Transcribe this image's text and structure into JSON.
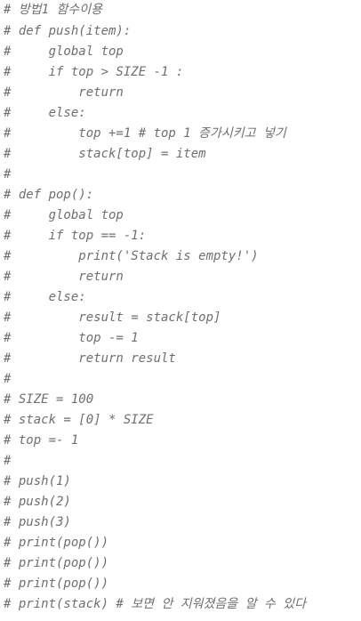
{
  "editor": {
    "lines": [
      "# 방법1 함수이용",
      "# def push(item):",
      "#     global top",
      "#     if top > SIZE -1 :",
      "#         return",
      "#     else:",
      "#         top +=1 # top 1 증가시키고 넣기",
      "#         stack[top] = item",
      "#",
      "# def pop():",
      "#     global top",
      "#     if top == -1:",
      "#         print('Stack is empty!')",
      "#         return",
      "#     else:",
      "#         result = stack[top]",
      "#         top -= 1",
      "#         return result",
      "#",
      "# SIZE = 100",
      "# stack = [0] * SIZE",
      "# top =- 1",
      "#",
      "# push(1)",
      "# push(2)",
      "# push(3)",
      "# print(pop())",
      "# print(pop())",
      "# print(pop())",
      "# print(stack) # 보면 안 지워졌음을 알 수 있다"
    ],
    "comment_color": "#6f6f6f",
    "background_color": "#ffffff"
  }
}
